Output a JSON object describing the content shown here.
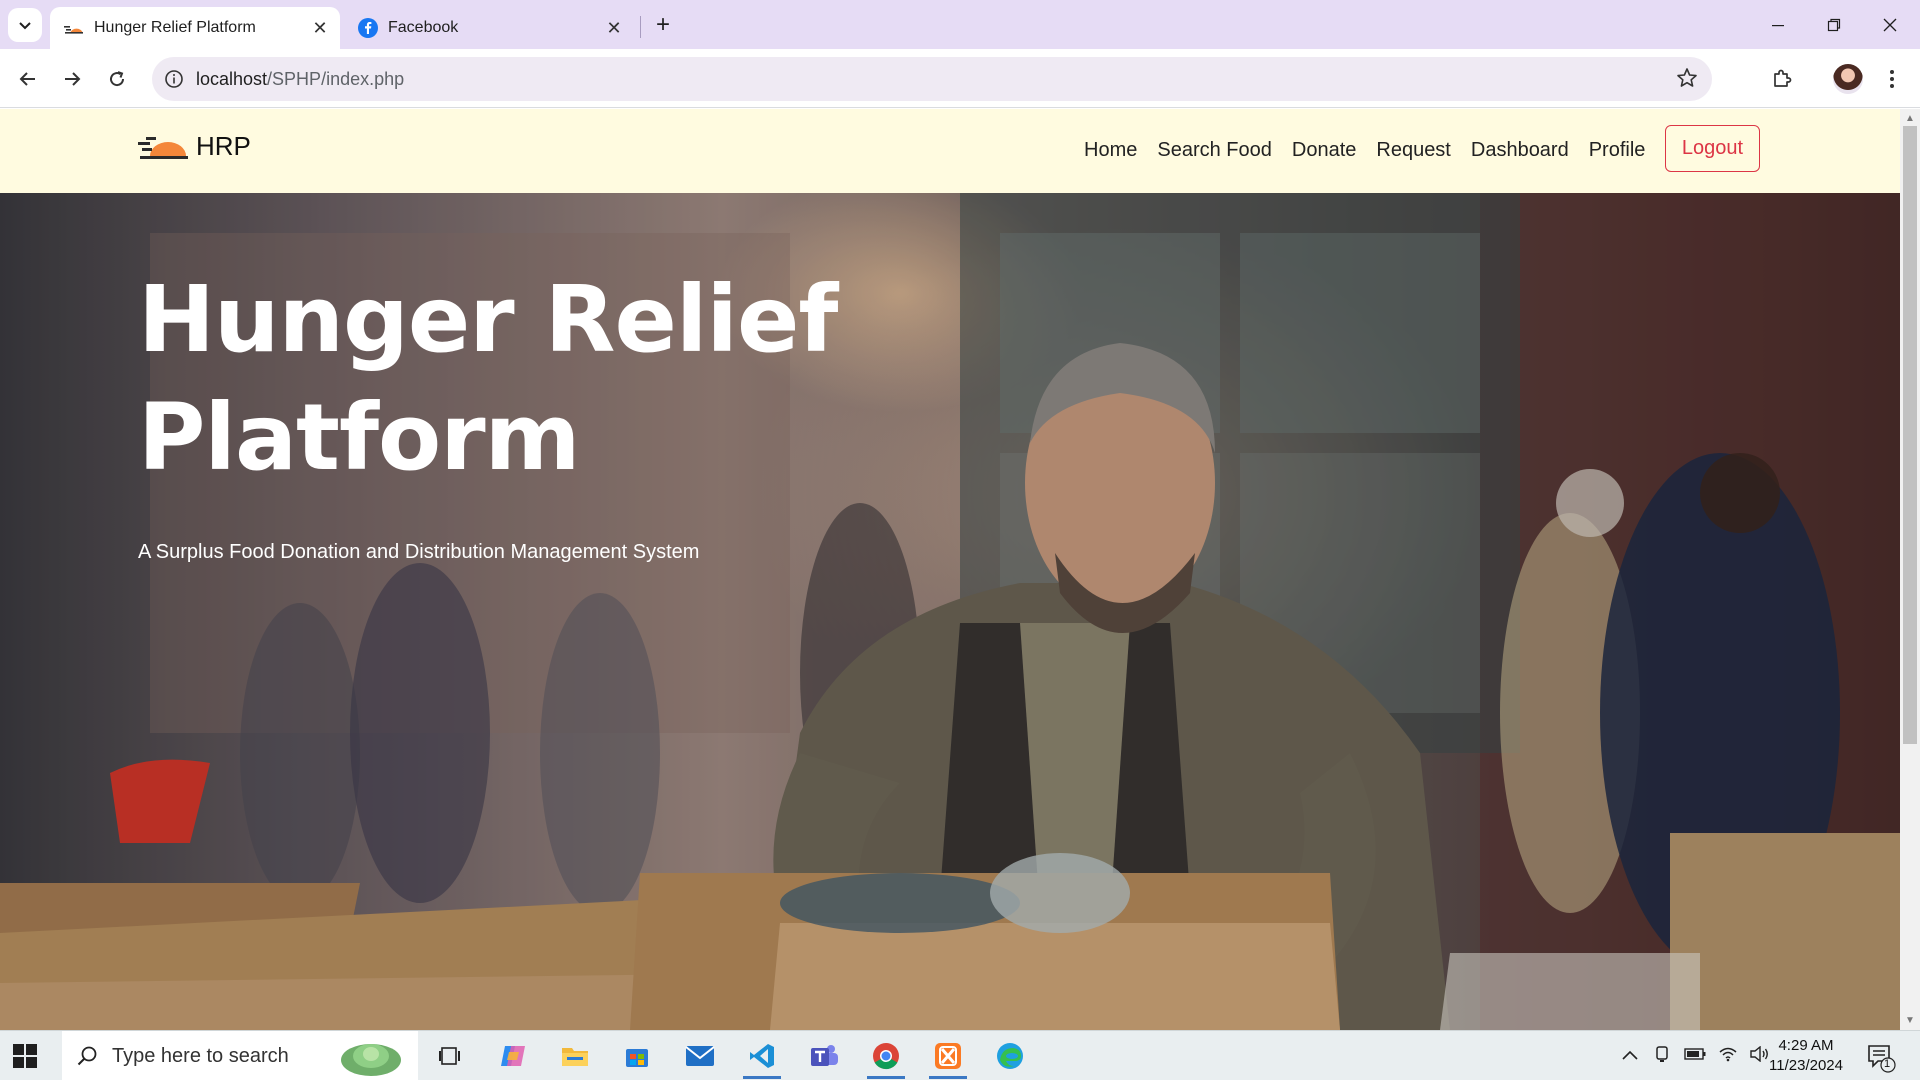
{
  "browser": {
    "tabs": [
      {
        "title": "Hunger Relief Platform",
        "active": true
      },
      {
        "title": "Facebook",
        "active": false
      }
    ],
    "url": {
      "host": "localhost",
      "path": "/SPHP/index.php"
    }
  },
  "site": {
    "brand": "HRP",
    "nav": [
      "Home",
      "Search Food",
      "Donate",
      "Request",
      "Dashboard",
      "Profile"
    ],
    "logout_label": "Logout",
    "hero": {
      "title": "Hunger Relief Platform",
      "subtitle": "A Surplus Food Donation and Distribution Management System"
    }
  },
  "taskbar": {
    "search_placeholder": "Type here to search",
    "time": "4:29 AM",
    "date": "11/23/2024",
    "notification_count": "1"
  },
  "colors": {
    "navbar_bg": "#fffbe0",
    "logout": "#dc3545",
    "tabstrip": "#e6dcf5"
  }
}
